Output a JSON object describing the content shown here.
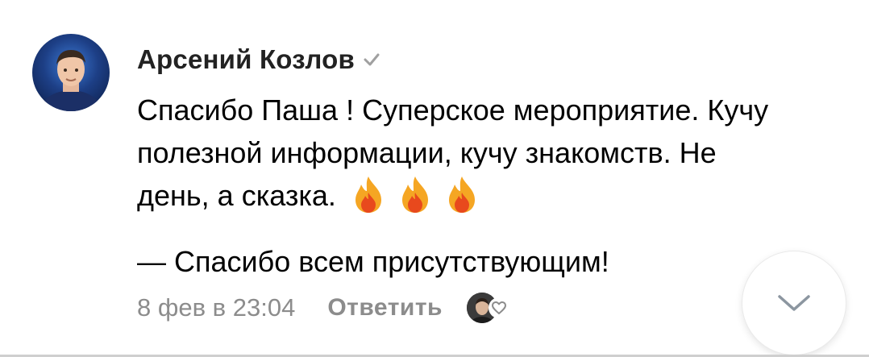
{
  "comment": {
    "author_name": "Арсений Козлов",
    "verified_icon": "checkmark-icon",
    "avatar_icon": "user-avatar",
    "text_lines": [
      "Спасибо Паша ! Суперское мероприятие. Кучу",
      "полезной информации, кучу знакомств. Не",
      "день, а сказка."
    ],
    "emoji_icons": [
      "fire-icon",
      "fire-icon",
      "fire-icon"
    ],
    "reply_quote": "— Спасибо всем присутствующим!",
    "timestamp": "8 фев в 23:04",
    "reply_label": "Ответить",
    "like_icon": "heart-icon"
  },
  "navigation": {
    "scroll_down_icon": "chevron-down-icon"
  },
  "colors": {
    "text_primary": "#000000",
    "text_secondary": "#8c8c8c",
    "author_name": "#222222",
    "verified": "#a0a0a0",
    "fire_outer": "#f5a623",
    "fire_inner": "#e8491d"
  }
}
